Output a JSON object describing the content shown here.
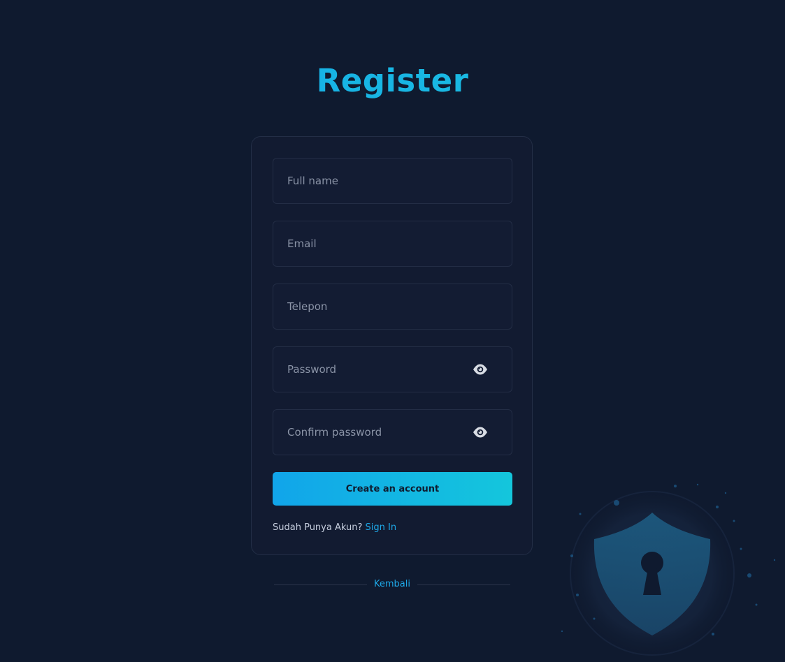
{
  "page": {
    "title": "Register"
  },
  "form": {
    "full_name_placeholder": "Full name",
    "email_placeholder": "Email",
    "phone_placeholder": "Telepon",
    "password_placeholder": "Password",
    "confirm_password_placeholder": "Confirm password",
    "submit_label": "Create an account",
    "have_account_text": "Sudah Punya Akun?",
    "sign_in_label": "Sign In"
  },
  "footer": {
    "back_label": "Kembali"
  },
  "icons": {
    "password_toggle": "eye-icon",
    "decoration": "shield-keyhole-icon"
  },
  "colors": {
    "background": "#0f1a2f",
    "card": "#121b31",
    "accent_start": "#11a5ea",
    "accent_end": "#14c6dc",
    "link": "#1ea8e7"
  }
}
